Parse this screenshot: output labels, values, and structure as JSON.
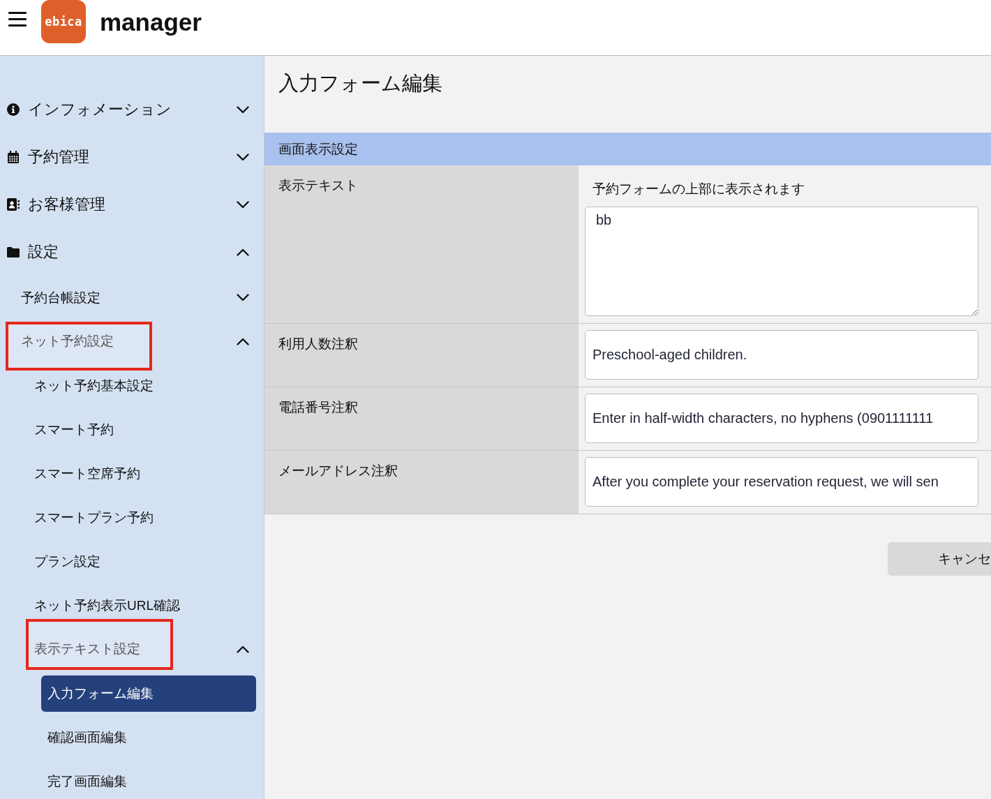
{
  "header": {
    "logo_text": "ebica",
    "app_name": "manager"
  },
  "sidebar": {
    "items": [
      {
        "label": "インフォメーション",
        "expanded": false,
        "selected": false,
        "annotated": false
      },
      {
        "label": "予約管理",
        "expanded": false,
        "selected": false,
        "annotated": false
      },
      {
        "label": "お客様管理",
        "expanded": false,
        "selected": false,
        "annotated": false
      },
      {
        "label": "設定",
        "expanded": true,
        "selected": false,
        "annotated": false,
        "children": [
          {
            "label": "予約台帳設定",
            "expanded": false,
            "selected": false,
            "annotated": false
          },
          {
            "label": "ネット予約設定",
            "expanded": true,
            "selected": false,
            "annotated": true,
            "children": [
              {
                "label": "ネット予約基本設定",
                "selected": false,
                "annotated": false
              },
              {
                "label": "スマート予約",
                "selected": false,
                "annotated": false
              },
              {
                "label": "スマート空席予約",
                "selected": false,
                "annotated": false
              },
              {
                "label": "スマートプラン予約",
                "selected": false,
                "annotated": false
              },
              {
                "label": "プラン設定",
                "selected": false,
                "annotated": false
              },
              {
                "label": "ネット予約表示URL確認",
                "selected": false,
                "annotated": false
              },
              {
                "label": "表示テキスト設定",
                "expanded": true,
                "selected": false,
                "annotated": true,
                "children": [
                  {
                    "label": "入力フォーム編集",
                    "selected": true,
                    "annotated": false
                  },
                  {
                    "label": "確認画面編集",
                    "selected": false,
                    "annotated": false
                  },
                  {
                    "label": "完了画面編集",
                    "selected": false,
                    "annotated": false
                  }
                ]
              }
            ]
          }
        ]
      }
    ]
  },
  "page": {
    "title": "入力フォーム編集"
  },
  "form": {
    "section_title": "画面表示設定",
    "rows": [
      {
        "kind": "textarea",
        "label": "表示テキスト",
        "hint": "予約フォームの上部に表示されます",
        "value": "bb"
      },
      {
        "kind": "input",
        "label": "利用人数注釈",
        "value": "Preschool-aged children."
      },
      {
        "kind": "input",
        "label": "電話番号注釈",
        "value": "Enter in half-width characters, no hyphens (0901111111"
      },
      {
        "kind": "input",
        "label": "メールアドレス注釈",
        "value": "After you complete your reservation request, we will sen"
      }
    ]
  },
  "buttons": [
    {
      "label": "キャンセ"
    }
  ]
}
